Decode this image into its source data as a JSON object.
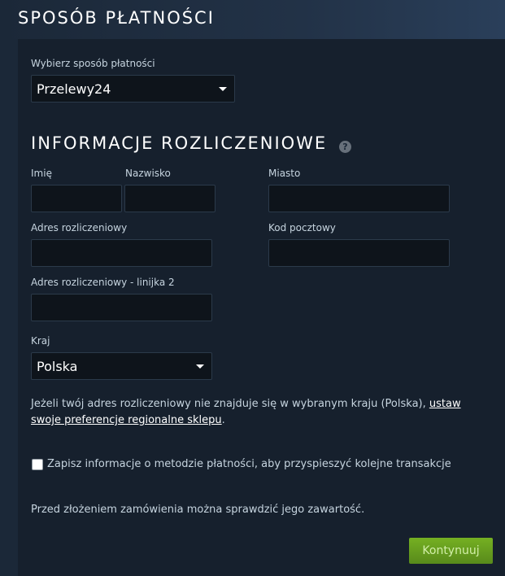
{
  "header": {
    "title": "SPOSÓB PŁATNOŚCI"
  },
  "payment": {
    "label": "Wybierz sposób płatności",
    "selected": "Przelewy24"
  },
  "billing": {
    "title": "INFORMACJE ROZLICZENIOWE",
    "help_icon": "question-icon",
    "first_name_label": "Imię",
    "last_name_label": "Nazwisko",
    "city_label": "Miasto",
    "address_label": "Adres rozliczeniowy",
    "postal_code_label": "Kod pocztowy",
    "address2_label": "Adres rozliczeniowy - linijka 2",
    "country_label": "Kraj",
    "country_selected": "Polska"
  },
  "note": {
    "text": "Jeżeli twój adres rozliczeniowy nie znajduje się w wybranym kraju (Polska), ",
    "link": "ustaw swoje preferencje regionalne sklepu",
    "end": "."
  },
  "save_info": {
    "label": "Zapisz informacje o metodzie płatności, aby przyspieszyć kolejne transakcje",
    "checked": false
  },
  "review_note": "Przed złożeniem zamówienia można sprawdzić jego zawartość.",
  "continue_button": "Kontynuuj",
  "colors": {
    "background": "#1b2838",
    "panel": "#16202d",
    "input_bg": "#0e141b",
    "accent_green": "#75b022"
  }
}
